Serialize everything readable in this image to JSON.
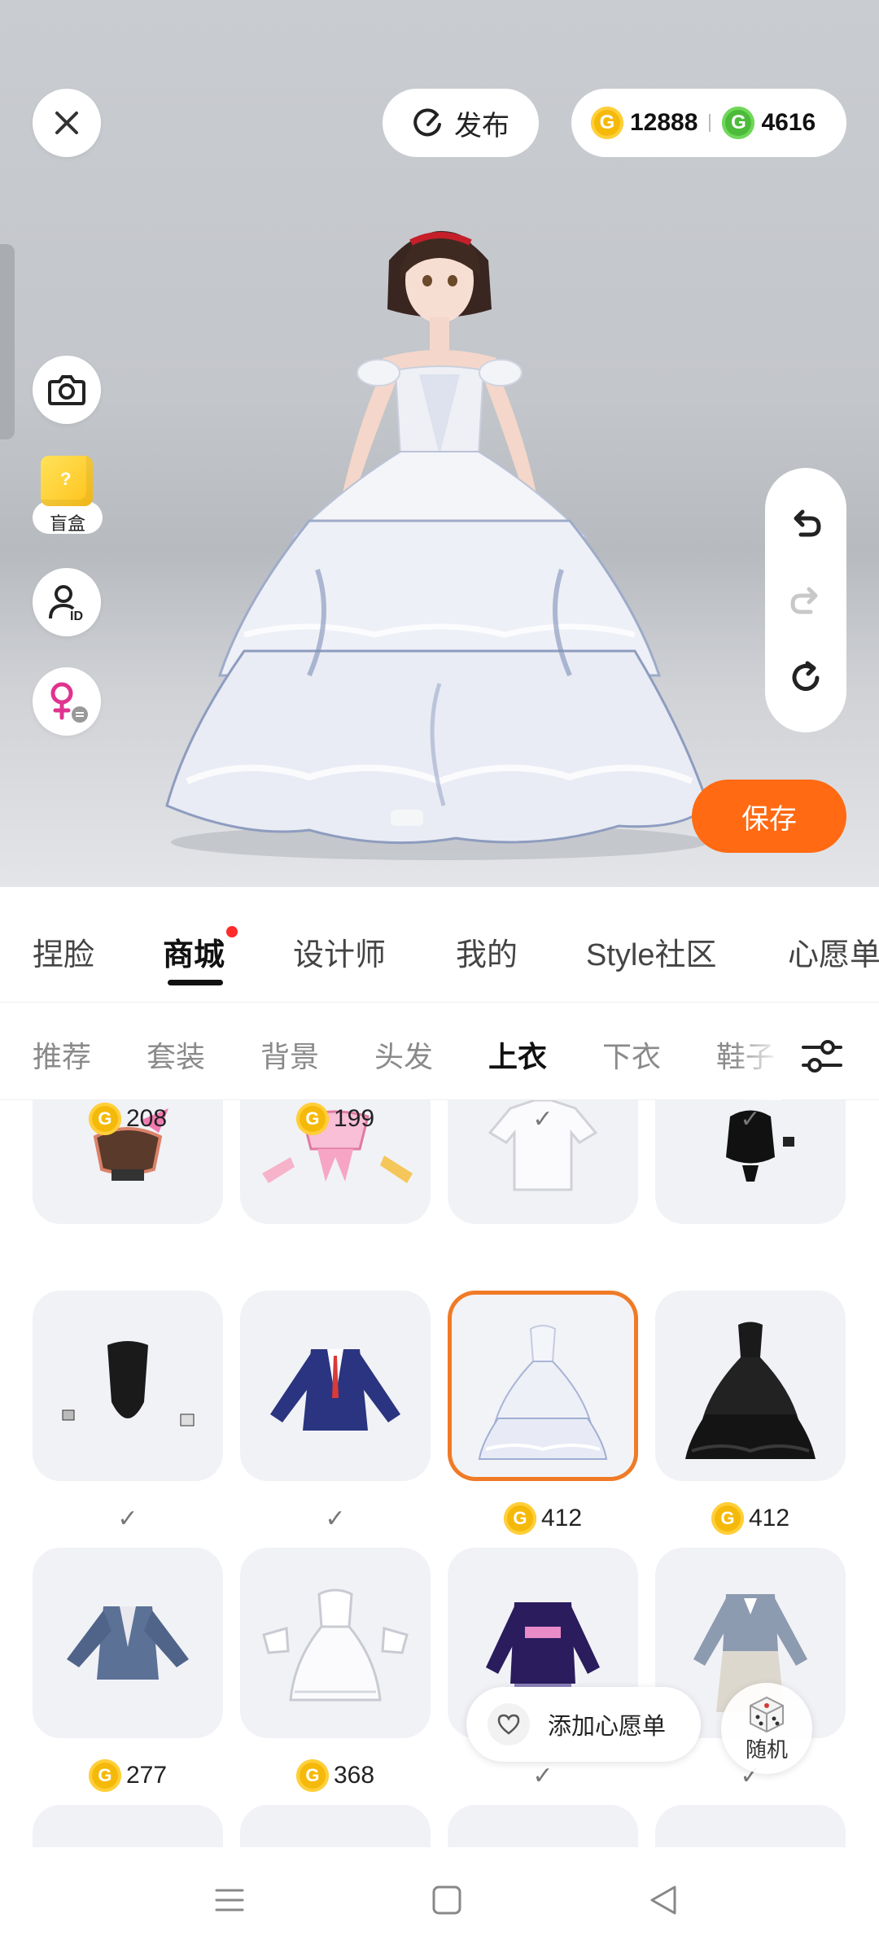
{
  "header": {
    "publish_label": "发布",
    "gold_amount": "12888",
    "green_amount": "4616",
    "coin_glyph": "G"
  },
  "side": {
    "blindbox_label": "盲盒"
  },
  "actions": {
    "save_label": "保存"
  },
  "main_tabs": [
    {
      "label": "捏脸"
    },
    {
      "label": "商城"
    },
    {
      "label": "设计师"
    },
    {
      "label": "我的"
    },
    {
      "label": "Style社区"
    },
    {
      "label": "心愿单"
    }
  ],
  "sub_tabs": [
    {
      "label": "推荐"
    },
    {
      "label": "套装"
    },
    {
      "label": "背景"
    },
    {
      "label": "头发"
    },
    {
      "label": "上衣"
    },
    {
      "label": "下衣"
    },
    {
      "label": "鞋子"
    }
  ],
  "items": [
    {
      "kind": "crop-top-skirt",
      "price": "208"
    },
    {
      "kind": "pink-outfit-set",
      "price": "199"
    },
    {
      "kind": "white-tshirt",
      "status": "owned"
    },
    {
      "kind": "black-top",
      "status": "owned"
    },
    {
      "kind": "black-leotard",
      "status": "owned"
    },
    {
      "kind": "navy-blazer",
      "status": "owned"
    },
    {
      "kind": "white-ball-gown",
      "price": "412",
      "selected": true
    },
    {
      "kind": "black-ball-gown",
      "price": "412"
    },
    {
      "kind": "denim-jacket",
      "price": "277"
    },
    {
      "kind": "white-lolita-dress",
      "price": "368"
    },
    {
      "kind": "purple-sweater-plaid",
      "status": "owned"
    },
    {
      "kind": "school-uniform",
      "status": "owned"
    }
  ],
  "floating": {
    "wishlist_label": "添加心愿单",
    "random_label": "随机"
  },
  "colors": {
    "accent": "#ff6a13",
    "selected_border": "#f07a26",
    "gold_coin": "#f5b90a",
    "green_coin": "#4dbb3a"
  }
}
